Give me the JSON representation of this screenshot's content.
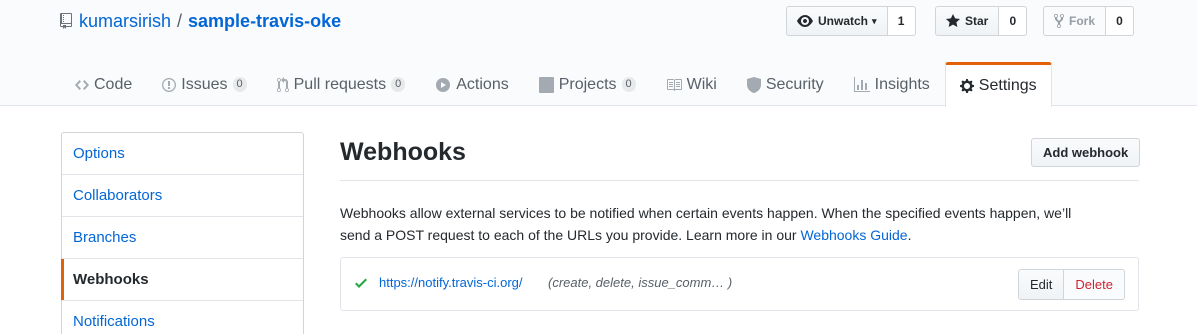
{
  "repo": {
    "owner": "kumarsirish",
    "separator": "/",
    "name": "sample-travis-oke"
  },
  "actions": [
    {
      "label": "Unwatch",
      "icon": "eye-icon",
      "count": "1",
      "caret": "▾"
    },
    {
      "label": "Star",
      "icon": "star-icon",
      "count": "0"
    },
    {
      "label": "Fork",
      "icon": "fork-icon",
      "count": "0",
      "disabled": true
    }
  ],
  "tabs": [
    {
      "label": "Code",
      "icon": "code-icon",
      "counter": ""
    },
    {
      "label": "Issues",
      "icon": "issue-icon",
      "counter": "0"
    },
    {
      "label": "Pull requests",
      "icon": "pull-request-icon",
      "counter": "0"
    },
    {
      "label": "Actions",
      "icon": "play-icon",
      "counter": ""
    },
    {
      "label": "Projects",
      "icon": "project-icon",
      "counter": "0"
    },
    {
      "label": "Wiki",
      "icon": "book-icon",
      "counter": ""
    },
    {
      "label": "Security",
      "icon": "shield-icon",
      "counter": ""
    },
    {
      "label": "Insights",
      "icon": "graph-icon",
      "counter": ""
    },
    {
      "label": "Settings",
      "icon": "gear-icon",
      "counter": "",
      "selected": true
    }
  ],
  "menu": {
    "items": [
      {
        "label": "Options"
      },
      {
        "label": "Collaborators"
      },
      {
        "label": "Branches"
      },
      {
        "label": "Webhooks",
        "selected": true
      },
      {
        "label": "Notifications"
      }
    ]
  },
  "main": {
    "title": "Webhooks",
    "add_button": "Add webhook",
    "description_line1": "Webhooks allow external services to be notified when certain events happen. When the specified events happen, we’ll",
    "description_line2": "send a POST request to each of the URLs you provide. Learn more in our ",
    "guide_link": "Webhooks Guide",
    "description_end": "."
  },
  "webhook": {
    "url": "https://notify.travis-ci.org/",
    "events": "(create, delete, issue_comm… )",
    "edit_label": "Edit",
    "delete_label": "Delete"
  },
  "colors": {
    "link": "#0366d6",
    "accent": "#e36209",
    "success": "#28a745",
    "danger": "#cb2431"
  }
}
